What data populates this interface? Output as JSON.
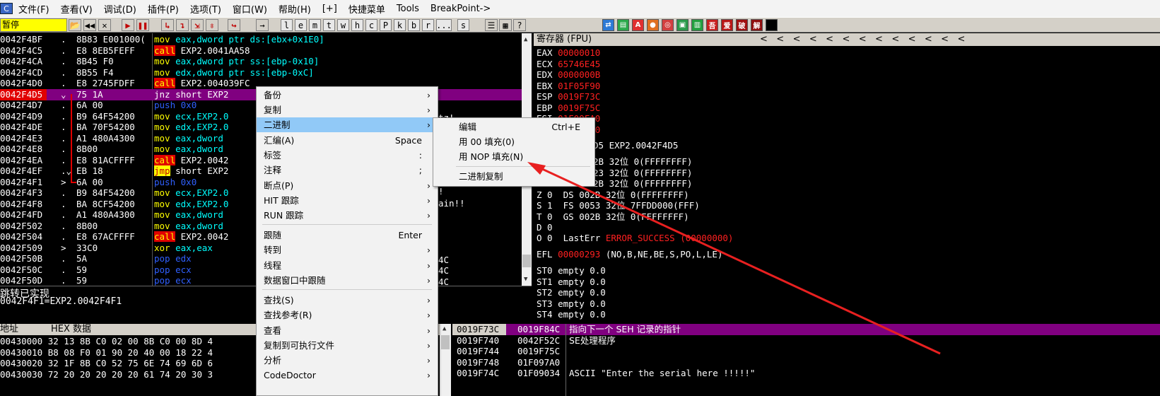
{
  "menubar": {
    "icon": "C",
    "items": [
      "文件(F)",
      "查看(V)",
      "调试(D)",
      "插件(P)",
      "选项(T)",
      "窗口(W)",
      "帮助(H)",
      "[+]",
      "快捷菜单",
      "Tools",
      "BreakPoint->"
    ]
  },
  "toolbar": {
    "status": "暂停",
    "letters": [
      "l",
      "e",
      "m",
      "t",
      "w",
      "h",
      "c",
      "P",
      "k",
      "b",
      "r",
      "...",
      "s"
    ],
    "right_icons": [
      "tb-icon",
      "tb-icon",
      "A",
      "tb-icon",
      "tb-icon",
      "tb-icon",
      "tb-icon",
      "吾",
      "爱",
      "破",
      "解"
    ]
  },
  "disasm": {
    "rows": [
      {
        "addr": "0042F4BF",
        "mark": ".",
        "hex": "8B83 E001000(",
        "mn": "mov",
        "ops": "eax,dword ptr ds:[ebx+0x1E0]",
        "kind": "mov"
      },
      {
        "addr": "0042F4C5",
        "mark": ".",
        "hex": "E8 8EB5FEFF",
        "mn": "call",
        "ops": "EXP2.0041AA58",
        "kind": "call"
      },
      {
        "addr": "0042F4CA",
        "mark": ".",
        "hex": "8B45 F0",
        "mn": "mov",
        "ops": "eax,dword ptr ss:[ebp-0x10]",
        "kind": "mov"
      },
      {
        "addr": "0042F4CD",
        "mark": ".",
        "hex": "8B55 F4",
        "mn": "mov",
        "ops": "edx,dword ptr ss:[ebp-0xC]",
        "kind": "mov"
      },
      {
        "addr": "0042F4D0",
        "mark": ".",
        "hex": "E8 2745FDFF",
        "mn": "call",
        "ops": "EXP2.004039FC",
        "kind": "call"
      },
      {
        "addr": "0042F4D5",
        "mark": "⌄",
        "hex": "75 1A",
        "mn": "jnz",
        "ops": "short EXP2",
        "kind": "jnz"
      },
      {
        "addr": "0042F4D7",
        "mark": ".",
        "hex": "6A 00",
        "mn": "push",
        "ops": "0x0",
        "kind": "push"
      },
      {
        "addr": "0042F4D9",
        "mark": ".",
        "hex": "B9 64F54200",
        "mn": "mov",
        "ops": "ecx,EXP2.0",
        "kind": "mov"
      },
      {
        "addr": "0042F4DE",
        "mark": ".",
        "hex": "BA 70F54200",
        "mn": "mov",
        "ops": "edx,EXP2.0",
        "kind": "mov"
      },
      {
        "addr": "0042F4E3",
        "mark": ".",
        "hex": "A1 480A4300",
        "mn": "mov",
        "ops": "eax,dword",
        "kind": "mov"
      },
      {
        "addr": "0042F4E8",
        "mark": ".",
        "hex": "8B00",
        "mn": "mov",
        "ops": "eax,dword",
        "kind": "mov"
      },
      {
        "addr": "0042F4EA",
        "mark": ".",
        "hex": "E8 81ACFFFF",
        "mn": "call",
        "ops": "EXP2.0042",
        "kind": "call"
      },
      {
        "addr": "0042F4EF",
        "mark": ".⌄",
        "hex": "EB 18",
        "mn": "jmp",
        "ops": "short EXP2",
        "kind": "jmp"
      },
      {
        "addr": "0042F4F1",
        "mark": ">",
        "hex": "6A 00",
        "mn": "push",
        "ops": "0x0",
        "kind": "push"
      },
      {
        "addr": "0042F4F3",
        "mark": ".",
        "hex": "B9 84F54200",
        "mn": "mov",
        "ops": "ecx,EXP2.0",
        "kind": "mov"
      },
      {
        "addr": "0042F4F8",
        "mark": ".",
        "hex": "BA 8CF54200",
        "mn": "mov",
        "ops": "edx,EXP2.0",
        "kind": "mov"
      },
      {
        "addr": "0042F4FD",
        "mark": ".",
        "hex": "A1 480A4300",
        "mn": "mov",
        "ops": "eax,dword",
        "kind": "mov"
      },
      {
        "addr": "0042F502",
        "mark": ".",
        "hex": "8B00",
        "mn": "mov",
        "ops": "eax,dword",
        "kind": "mov"
      },
      {
        "addr": "0042F504",
        "mark": ".",
        "hex": "E8 67ACFFFF",
        "mn": "call",
        "ops": "EXP2.0042",
        "kind": "call"
      },
      {
        "addr": "0042F509",
        "mark": ">",
        "hex": "33C0",
        "mn": "xor",
        "ops": "eax,eax",
        "kind": "xor"
      },
      {
        "addr": "0042F50B",
        "mark": ".",
        "hex": "5A",
        "mn": "pop",
        "ops": "edx",
        "kind": "pop"
      },
      {
        "addr": "0042F50C",
        "mark": ".",
        "hex": "59",
        "mn": "pop",
        "ops": "ecx",
        "kind": "pop"
      },
      {
        "addr": "0042F50D",
        "mark": ".",
        "hex": "59",
        "mn": "pop",
        "ops": "ecx",
        "kind": "pop"
      }
    ],
    "right_fragments": [
      "tz!",
      "!",
      "ain!!",
      "4C",
      "4C",
      "4C"
    ]
  },
  "info": {
    "line1": "跳转已实现",
    "line2": "0042F4F1=EXP2.0042F4F1"
  },
  "registers": {
    "header": "寄存器 (FPU)",
    "arrows": "<   <   <   <   <   <   <   <   <   <   <   <   <",
    "gp": [
      {
        "name": "EAX",
        "value": "00000010"
      },
      {
        "name": "ECX",
        "value": "65746E45"
      },
      {
        "name": "EDX",
        "value": "0000000B"
      },
      {
        "name": "EBX",
        "value": "01F05F90"
      },
      {
        "name": "ESP",
        "value": "0019F73C"
      },
      {
        "name": "EBP",
        "value": "0019F75C"
      },
      {
        "name": "ESI",
        "value": "01F09FA0"
      },
      {
        "name": "EDI",
        "value": "019FBFA0"
      }
    ],
    "eip_tail": "D5 EXP2.0042F4D5",
    "segs": [
      {
        "text": "2B 32位 0(FFFFFFFF)"
      },
      {
        "text": "23 32位 0(FFFFFFFF)"
      },
      {
        "text": "2B 32位 0(FFFFFFFF)"
      },
      {
        "text": "Z 0  DS 002B 32位 0(FFFFFFFF)"
      },
      {
        "text": "S 1  FS 0053 32位 7FFDD000(FFF)"
      },
      {
        "text": "T 0  GS 002B 32位 0(FFFFFFFF)"
      },
      {
        "text": "D 0"
      }
    ],
    "lasterr_prefix": "O 0  LastErr ",
    "lasterr_value": "ERROR_SUCCESS (00000000)",
    "efl_label": "EFL ",
    "efl_value": "00000293",
    "efl_flags": " (NO,B,NE,BE,S,PO,L,LE)",
    "fpu": [
      "ST0 empty 0.0",
      "ST1 empty 0.0",
      "ST2 empty 0.0",
      "ST3 empty 0.0",
      "ST4 empty 0.0"
    ]
  },
  "hexdump": {
    "col_addr": "地址",
    "col_hex": "HEX 数据",
    "rows": [
      "00430000 32 13 8B C0 02 00 8B C0 00 8D 4",
      "00430010 B8 08 F0 01 90 20 40 00 18 22 4",
      "00430020 32 1F 8B C0 52 75 6E 74 69 6D 6",
      "00430030 72 20 20 20 20 20 61 74 20 30 3"
    ]
  },
  "stack": {
    "rows": [
      {
        "addr": "0019F73C",
        "val": "0019F84C",
        "comment": "指向下一个 SEH 记录的指针",
        "sel": true
      },
      {
        "addr": "0019F740",
        "val": "0042F52C",
        "comment": "SE处理程序",
        "sel": false
      },
      {
        "addr": "0019F744",
        "val": "0019F75C",
        "comment": "",
        "sel": false
      },
      {
        "addr": "0019F748",
        "val": "01F097A0",
        "comment": "",
        "sel": false
      },
      {
        "addr": "0019F74C",
        "val": "01F09034",
        "comment": "ASCII \"Enter the serial here !!!!!\"",
        "sel": false
      }
    ]
  },
  "context_menu": {
    "items": [
      {
        "label": "备份",
        "shortcut": "",
        "arrow": true
      },
      {
        "label": "复制",
        "shortcut": "",
        "arrow": true
      },
      {
        "label": "二进制",
        "shortcut": "",
        "arrow": true,
        "highlight": true
      },
      {
        "label": "汇编(A)",
        "shortcut": "Space",
        "arrow": false
      },
      {
        "label": "标签",
        "shortcut": ":",
        "arrow": false
      },
      {
        "label": "注释",
        "shortcut": ";",
        "arrow": false
      },
      {
        "label": "断点(P)",
        "shortcut": "",
        "arrow": true
      },
      {
        "label": "HIT 跟踪",
        "shortcut": "",
        "arrow": true
      },
      {
        "label": "RUN 跟踪",
        "shortcut": "",
        "arrow": true
      },
      {
        "label": "跟随",
        "shortcut": "Enter",
        "arrow": false
      },
      {
        "label": "转到",
        "shortcut": "",
        "arrow": true
      },
      {
        "label": "线程",
        "shortcut": "",
        "arrow": true
      },
      {
        "label": "数据窗口中跟随",
        "shortcut": "",
        "arrow": true
      },
      {
        "label": "查找(S)",
        "shortcut": "",
        "arrow": true
      },
      {
        "label": "查找参考(R)",
        "shortcut": "",
        "arrow": true
      },
      {
        "label": "查看",
        "shortcut": "",
        "arrow": true
      },
      {
        "label": "复制到可执行文件",
        "shortcut": "",
        "arrow": true
      },
      {
        "label": "分析",
        "shortcut": "",
        "arrow": true
      },
      {
        "label": "CodeDoctor",
        "shortcut": "",
        "arrow": true
      }
    ],
    "submenu": [
      {
        "label": "编辑",
        "shortcut": "Ctrl+E"
      },
      {
        "label": "用 00 填充(0)",
        "shortcut": ""
      },
      {
        "label": "用 NOP 填充(N)",
        "shortcut": ""
      },
      {
        "label": "二进制复制",
        "shortcut": ""
      }
    ]
  },
  "colors": {
    "annotation_arrow": "#e82020",
    "selection": "#800080",
    "menu_highlight": "#91c9f7"
  }
}
